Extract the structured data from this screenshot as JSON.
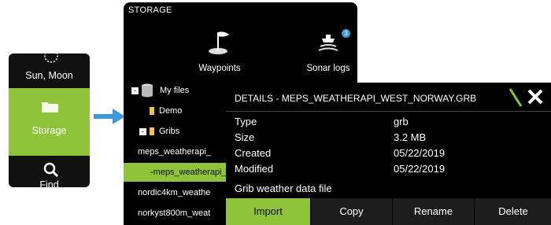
{
  "left_menu": {
    "items": [
      {
        "label": "Sun, Moon",
        "icon": "sun-moon-icon"
      },
      {
        "label": "Storage",
        "icon": "folder-icon",
        "active": true
      },
      {
        "label": "Find",
        "icon": "magnifier-icon"
      }
    ],
    "accent": "#8fc33a"
  },
  "storage": {
    "title": "STORAGE",
    "tiles": [
      {
        "label": "Waypoints",
        "icon": "waypoint-flag-icon"
      },
      {
        "label": "Sonar logs",
        "icon": "sonar-boat-icon",
        "badge": "3"
      }
    ],
    "tree": [
      {
        "label": "My files",
        "expander": "-"
      },
      {
        "label": "Demo"
      },
      {
        "label": "Gribs",
        "expander": "-"
      },
      {
        "label": "meps_weatherapi_"
      },
      {
        "label": "-meps_weatherapi_",
        "selected": true
      },
      {
        "label": "nordic4km_weathe"
      },
      {
        "label": "norkyst800m_weat"
      }
    ]
  },
  "details": {
    "title": "DETAILS - MEPS_WEATHERAPI_WEST_NORWAY.GRB",
    "fields": [
      {
        "key": "Type",
        "value": "grb"
      },
      {
        "key": "Size",
        "value": "3.2 MB"
      },
      {
        "key": "Created",
        "value": "05/22/2019"
      },
      {
        "key": "Modified",
        "value": "05/22/2019"
      }
    ],
    "description": "Grib weather data file",
    "buttons": [
      {
        "label": "Import"
      },
      {
        "label": "Copy"
      },
      {
        "label": "Rename"
      },
      {
        "label": "Delete"
      }
    ]
  }
}
